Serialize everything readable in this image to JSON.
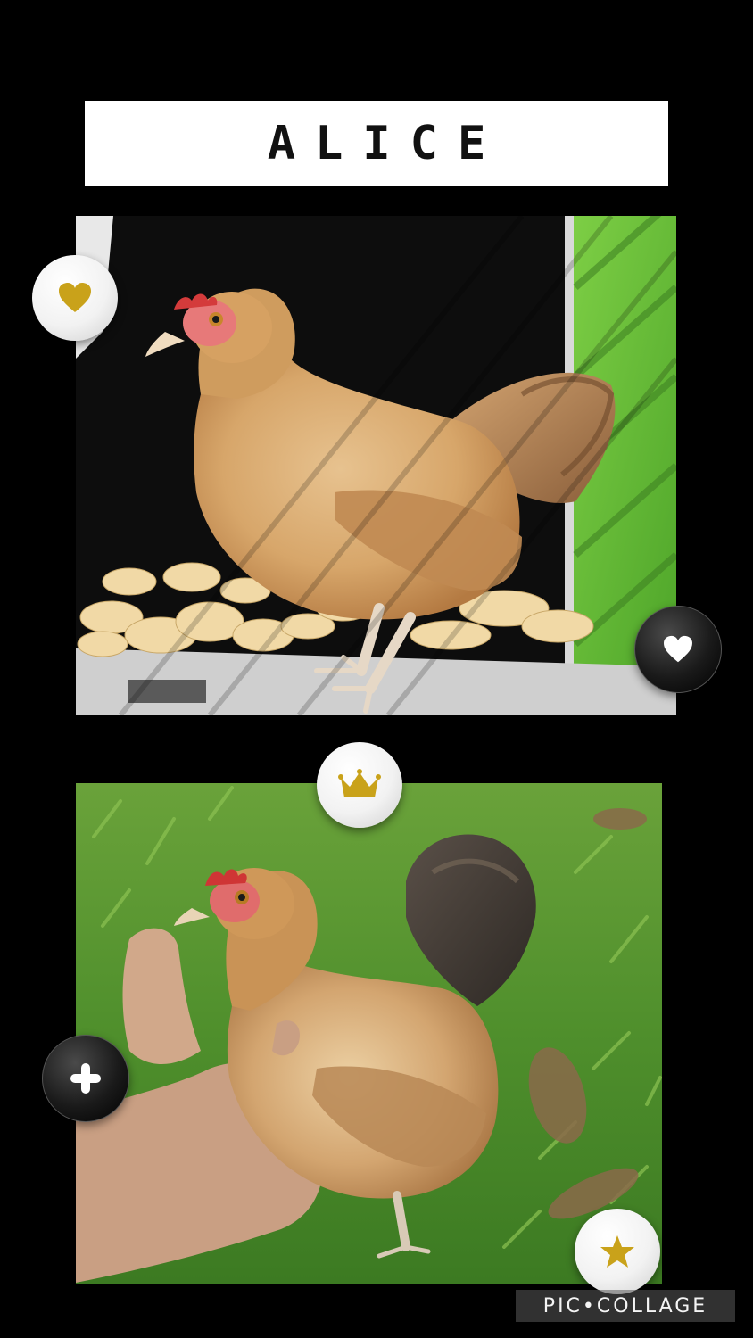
{
  "title": "ALICE",
  "photos": [
    {
      "subject": "hen-in-coop"
    },
    {
      "subject": "hen-held-in-hand-on-grass"
    }
  ],
  "stickers": [
    {
      "icon": "heart-icon",
      "style": "white",
      "icon_color": "#c9a21a"
    },
    {
      "icon": "heart-icon",
      "style": "black",
      "icon_color": "#ffffff"
    },
    {
      "icon": "crown-icon",
      "style": "white",
      "icon_color": "#c9a21a"
    },
    {
      "icon": "plus-icon",
      "style": "black",
      "icon_color": "#ffffff"
    },
    {
      "icon": "star-icon",
      "style": "white",
      "icon_color": "#c9a21a"
    }
  ],
  "watermark": "PIC•COLLAGE",
  "colors": {
    "background": "#000000",
    "banner": "#ffffff",
    "gold": "#c9a21a"
  }
}
